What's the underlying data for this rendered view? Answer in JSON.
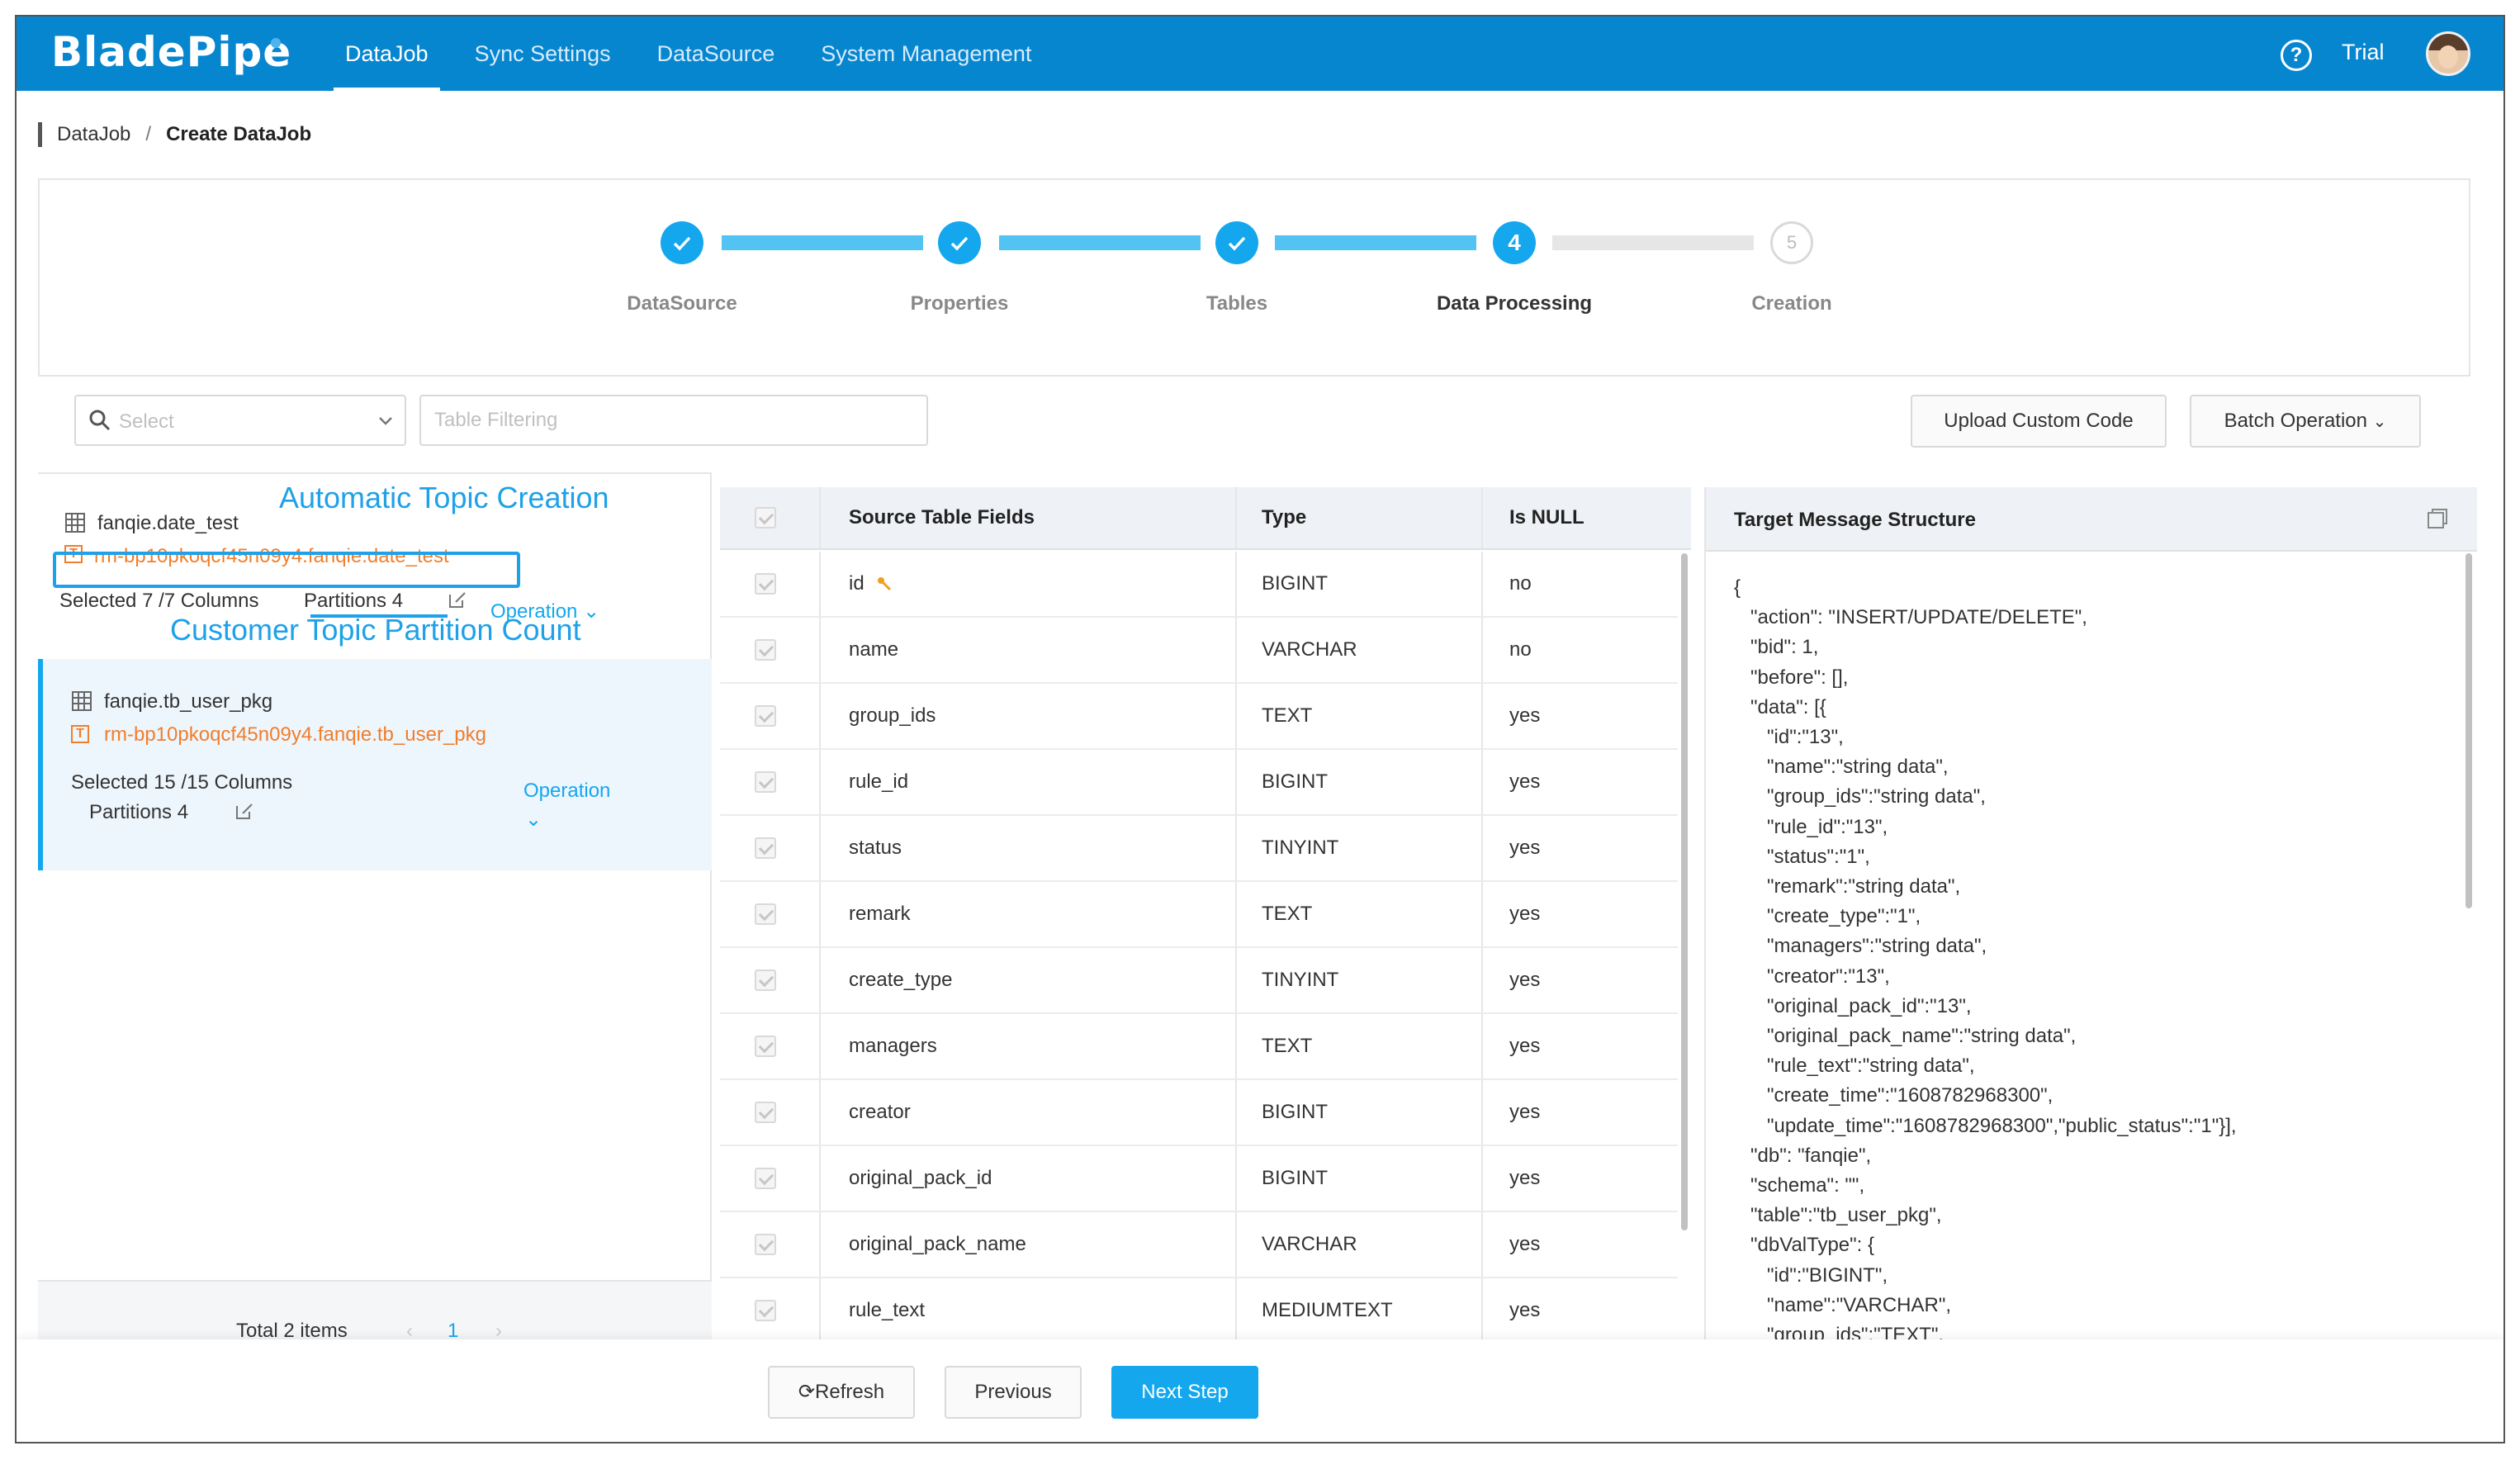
{
  "header": {
    "logo": "BladePipe",
    "nav": [
      "DataJob",
      "Sync Settings",
      "DataSource",
      "System Management"
    ],
    "active_nav": "DataJob",
    "user_label": "Trial"
  },
  "breadcrumb": {
    "parent": "DataJob",
    "separator": "/",
    "current": "Create DataJob"
  },
  "steps": [
    {
      "label": "DataSource",
      "state": "done"
    },
    {
      "label": "Properties",
      "state": "done"
    },
    {
      "label": "Tables",
      "state": "done"
    },
    {
      "label": "Data Processing",
      "state": "current",
      "number": "4"
    },
    {
      "label": "Creation",
      "state": "pending",
      "number": "5"
    }
  ],
  "toolbar": {
    "select_placeholder": "Select",
    "filter_placeholder": "Table Filtering",
    "upload_label": "Upload Custom Code",
    "batch_label": "Batch Operation"
  },
  "tables": [
    {
      "name": "fanqie.date_test",
      "topic": "rm-bp10pkoqcf45n09y4.fanqie.date_test",
      "columns": "Selected 7 /7 Columns",
      "partitions": "Partitions 4",
      "operation": "Operation"
    },
    {
      "name": "fanqie.tb_user_pkg",
      "topic": "rm-bp10pkoqcf45n09y4.fanqie.tb_user_pkg",
      "columns": "Selected 15 /15 Columns",
      "partitions": "Partitions 4",
      "operation": "Operation"
    }
  ],
  "annotations": {
    "topic_creation": "Automatic Topic Creation",
    "partition_count": "Customer Topic Partition Count"
  },
  "pager": {
    "total": "Total 2 items",
    "page": "1",
    "prev": "‹",
    "next": "›"
  },
  "field_table": {
    "headers": {
      "field": "Source Table Fields",
      "type": "Type",
      "null": "Is NULL"
    },
    "rows": [
      {
        "field": "id",
        "type": "BIGINT",
        "null": "no",
        "key": true
      },
      {
        "field": "name",
        "type": "VARCHAR",
        "null": "no"
      },
      {
        "field": "group_ids",
        "type": "TEXT",
        "null": "yes"
      },
      {
        "field": "rule_id",
        "type": "BIGINT",
        "null": "yes"
      },
      {
        "field": "status",
        "type": "TINYINT",
        "null": "yes"
      },
      {
        "field": "remark",
        "type": "TEXT",
        "null": "yes"
      },
      {
        "field": "create_type",
        "type": "TINYINT",
        "null": "yes"
      },
      {
        "field": "managers",
        "type": "TEXT",
        "null": "yes"
      },
      {
        "field": "creator",
        "type": "BIGINT",
        "null": "yes"
      },
      {
        "field": "original_pack_id",
        "type": "BIGINT",
        "null": "yes"
      },
      {
        "field": "original_pack_name",
        "type": "VARCHAR",
        "null": "yes"
      },
      {
        "field": "rule_text",
        "type": "MEDIUMTEXT",
        "null": "yes"
      }
    ]
  },
  "target": {
    "title": "Target Message Structure",
    "json_lines": [
      "{",
      "   \"action\": \"INSERT/UPDATE/DELETE\",",
      "   \"bid\": 1,",
      "   \"before\": [],",
      "   \"data\": [{",
      "      \"id\":\"13\",",
      "      \"name\":\"string data\",",
      "      \"group_ids\":\"string data\",",
      "      \"rule_id\":\"13\",",
      "      \"status\":\"1\",",
      "      \"remark\":\"string data\",",
      "      \"create_type\":\"1\",",
      "      \"managers\":\"string data\",",
      "      \"creator\":\"13\",",
      "      \"original_pack_id\":\"13\",",
      "      \"original_pack_name\":\"string data\",",
      "      \"rule_text\":\"string data\",",
      "      \"create_time\":\"1608782968300\",",
      "      \"update_time\":\"1608782968300\",\"public_status\":\"1\"}],",
      "   \"db\": \"fanqie\",",
      "   \"schema\": \"\",",
      "   \"table\":\"tb_user_pkg\",",
      "   \"dbValType\": {",
      "      \"id\":\"BIGINT\",",
      "      \"name\":\"VARCHAR\",",
      "      \"group_ids\":\"TEXT\","
    ]
  },
  "footer": {
    "refresh": "⟳Refresh",
    "previous": "Previous",
    "next": "Next Step"
  },
  "colors": {
    "brand": "#0786d0",
    "accent": "#14a7ee",
    "topic": "#f07e2b"
  }
}
